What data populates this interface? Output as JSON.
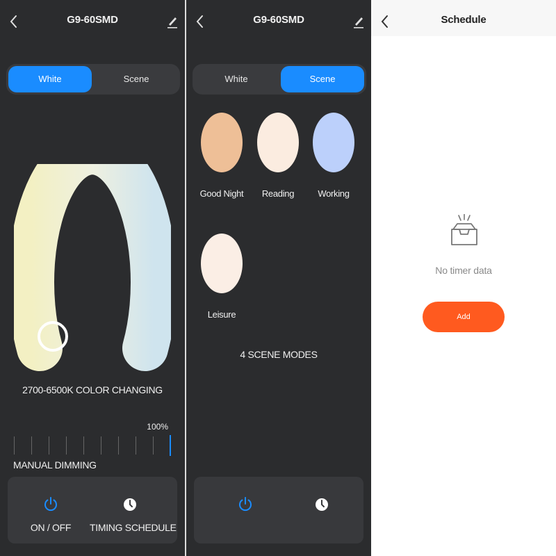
{
  "colors": {
    "accent": "#1a8cff",
    "dark_bg": "#2b2c2e",
    "add_button": "#ff5a1f"
  },
  "white_screen": {
    "title": "G9-60SMD",
    "tabs": [
      "White",
      "Scene"
    ],
    "active_tab": "White",
    "color_caption": "2700-6500K COLOR CHANGING",
    "brightness_percent": "100%",
    "brightness_value": 1.0,
    "dimming_label": "MANUAL DIMMING",
    "bottom_bar": {
      "power_label": "ON / OFF",
      "schedule_label": "TIMING SCHEDULE"
    },
    "icons": [
      "back-icon",
      "edit-icon",
      "power-icon",
      "clock-icon"
    ]
  },
  "scene_screen": {
    "title": "G9-60SMD",
    "tabs": [
      "White",
      "Scene"
    ],
    "active_tab": "Scene",
    "scenes": [
      {
        "label": "Good Night",
        "color": "#eebf97"
      },
      {
        "label": "Reading",
        "color": "#fbece0"
      },
      {
        "label": "Working",
        "color": "#bcd0fb"
      },
      {
        "label": "Leisure",
        "color": "#fbeee5"
      }
    ],
    "modes_caption": "4 SCENE MODES",
    "icons": [
      "back-icon",
      "edit-icon",
      "power-icon",
      "clock-icon"
    ]
  },
  "schedule_screen": {
    "title": "Schedule",
    "empty_text": "No timer data",
    "add_label": "Add",
    "icons": [
      "back-icon",
      "empty-inbox-icon"
    ]
  }
}
